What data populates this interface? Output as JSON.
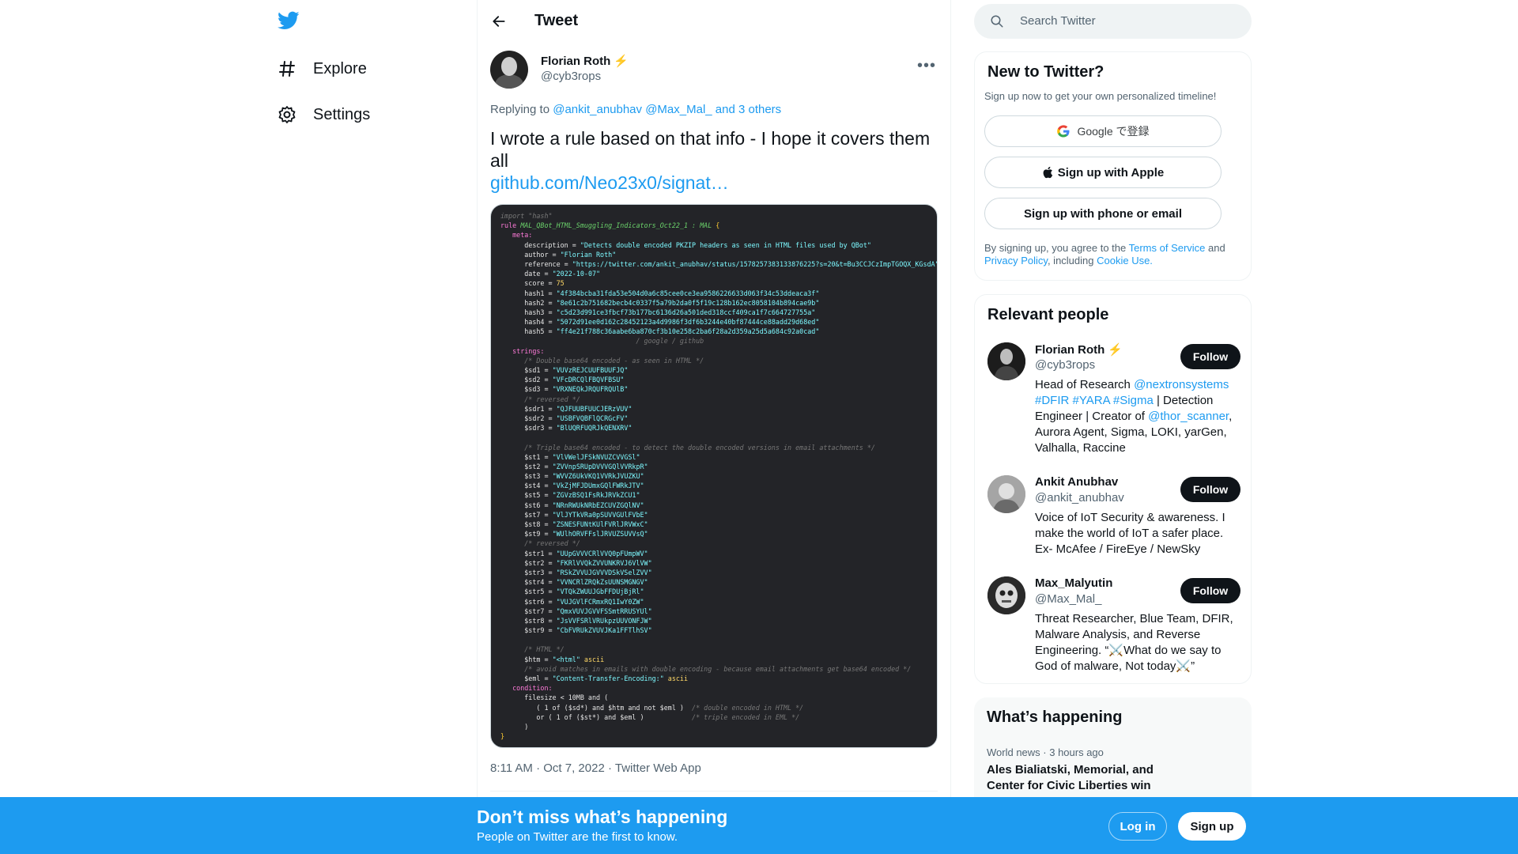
{
  "nav": {
    "logo_icon": "twitter-bird-icon",
    "explore_label": "Explore",
    "settings_label": "Settings"
  },
  "header": {
    "title": "Tweet"
  },
  "tweet": {
    "author_name": "Florian Roth",
    "author_badge": "⚡",
    "author_handle": "@cyb3rops",
    "replying_prefix": "Replying to",
    "replying_handles": "@ankit_anubhav @Max_Mal_ and 3 others",
    "text": "I wrote a rule based on that info - I hope it covers them all",
    "link": "github.com/Neo23x0/signat…",
    "meta": "8:11 AM · Oct 7, 2022 · Twitter Web App",
    "code_lines": [
      [
        "cmt",
        "import \"hash\""
      ],
      [
        "rule",
        "rule MAL_QBot_HTML_Smuggling_Indicators_Oct22_1 : MAL {"
      ],
      [
        "kw",
        "   meta:"
      ],
      [
        "kv",
        "      description = ",
        "\"Detects double encoded PKZIP headers as seen in HTML files used by QBot\""
      ],
      [
        "kv",
        "      author = ",
        "\"Florian Roth\""
      ],
      [
        "kv",
        "      reference = ",
        "\"https://twitter.com/ankit_anubhav/status/1578257383133876225?s=20&t=Bu3CCJCzImpTGOQX_KGsdA\""
      ],
      [
        "kv",
        "      date = ",
        "\"2022-10-07\""
      ],
      [
        "kn",
        "      score = ",
        "75"
      ],
      [
        "kv",
        "      hash1 = ",
        "\"4f384bcba31fda53e504d0a6c85cee0ce3ea9586226633d063f34c53ddeaca3f\""
      ],
      [
        "kv",
        "      hash2 = ",
        "\"8e61c2b751682becb4c0337f5a79b2da0f5f19c128b162ec8058104b894cae9b\""
      ],
      [
        "kv",
        "      hash3 = ",
        "\"c5d23d991ce3fbcf73b177bc6136d26a501ded318ccf409ca1f7c664727755a\""
      ],
      [
        "kv",
        "      hash4 = ",
        "\"5072d91ee0d162c28452123a4d9986f3df6b3244e40bf87444ce88add29d68ed\""
      ],
      [
        "kv",
        "      hash5 = ",
        "\"ff4e21f788c36aabe6ba870cf3b10e258c2ba6f28a2d359a25d5a684c92a0cad\""
      ],
      [
        "cmt",
        "                                  / google / github"
      ],
      [
        "kw",
        "   strings:"
      ],
      [
        "cmt",
        "      /* Double base64 encoded - as seen in HTML */"
      ],
      [
        "kv",
        "      $sd1 = ",
        "\"VUVzREJCUUFBUUFJQ\""
      ],
      [
        "kv",
        "      $sd2 = ",
        "\"VFcDRCQlFBQVFBSU\""
      ],
      [
        "kv",
        "      $sd3 = ",
        "\"VRXNEQkJRQUFRQUlB\""
      ],
      [
        "cmt",
        "      /* reversed */"
      ],
      [
        "kv",
        "      $sdr1 = ",
        "\"QJFUUBFUUCJERzVUV\""
      ],
      [
        "kv",
        "      $sdr2 = ",
        "\"USBFVQBFlQCRGcFV\""
      ],
      [
        "kv",
        "      $sdr3 = ",
        "\"BlUQRFUQRJkQENXRV\""
      ],
      [
        "blank",
        ""
      ],
      [
        "cmt",
        "      /* Triple base64 encoded - to detect the double encoded versions in email attachments */"
      ],
      [
        "kv",
        "      $st1 = ",
        "\"VlVWelJFSkNVUZCVVGSl\""
      ],
      [
        "kv",
        "      $st2 = ",
        "\"ZVVnpSRUpDVVVGQlVVRkpR\""
      ],
      [
        "kv",
        "      $st3 = ",
        "\"WVVZ6UkVKQ1VVRkJVUZKU\""
      ],
      [
        "kv",
        "      $st4 = ",
        "\"VkZjMFJDUmxGQlFWRkJTV\""
      ],
      [
        "kv",
        "      $st5 = ",
        "\"ZGVzBSQ1FsRkJRVkZCU1\""
      ],
      [
        "kv",
        "      $st6 = ",
        "\"NRnRWUkNRbEZCUVZGQlNV\""
      ],
      [
        "kv",
        "      $st7 = ",
        "\"VlJYTkVRa0pSUVVGUlFVbE\""
      ],
      [
        "kv",
        "      $st8 = ",
        "\"ZSNESFUNtKUlFVRlJRVWxC\""
      ],
      [
        "kv",
        "      $st9 = ",
        "\"WUlhORVFFslJRVUZSUVVsQ\""
      ],
      [
        "cmt",
        "      /* reversed */"
      ],
      [
        "kv",
        "      $str1 = ",
        "\"UUpGVVVCRlVVQ0pFUmpWV\""
      ],
      [
        "kv",
        "      $str2 = ",
        "\"FKRlVVQkZVVUNKRVJ6VlVW\""
      ],
      [
        "kv",
        "      $str3 = ",
        "\"RSkZVVUJGVVVDSkVSelZVV\""
      ],
      [
        "kv",
        "      $str4 = ",
        "\"VVNCRlZRQkZsUUNSMGNGV\""
      ],
      [
        "kv",
        "      $str5 = ",
        "\"VTQkZWUUJGbFFDUjBjRl\""
      ],
      [
        "kv",
        "      $str6 = ",
        "\"VUJGVlFCRmxRQ1IwY0ZW\""
      ],
      [
        "kv",
        "      $str7 = ",
        "\"QmxVUVJGVVFSSmtRRUSYUl\""
      ],
      [
        "kv",
        "      $str8 = ",
        "\"JsVVFSRlVRUkpzUUVONFJW\""
      ],
      [
        "kv",
        "      $str9 = ",
        "\"CbFVRUkZVUVJKa1FFTlhSV\""
      ],
      [
        "blank",
        ""
      ],
      [
        "cmt",
        "      /* HTML */"
      ],
      [
        "kva",
        "      $htm = ",
        "\"<html\"",
        "ascii"
      ],
      [
        "cmt",
        "      /* avoid matches in emails with double encoding - because email attachments get base64 encoded */"
      ],
      [
        "kva",
        "      $eml = ",
        "\"Content-Transfer-Encoding:\"",
        "ascii"
      ],
      [
        "kw",
        "   condition:"
      ],
      [
        "cond",
        "      filesize < 10MB and ("
      ],
      [
        "cond",
        "         ( 1 of ($sd*) and $htm and not $eml )  /* double encoded in HTML */"
      ],
      [
        "cond",
        "         or ( 1 of ($st*) and $eml )            /* triple encoded in EML */"
      ],
      [
        "cond",
        "      )"
      ],
      [
        "brace",
        "}"
      ]
    ]
  },
  "search": {
    "placeholder": "Search Twitter"
  },
  "new_to_twitter": {
    "title": "New to Twitter?",
    "subtitle": "Sign up now to get your own personalized timeline!",
    "google_label": "Google で登録",
    "apple_label": "Sign up with Apple",
    "phone_label": "Sign up with phone or email",
    "terms_prefix": "By signing up, you agree to the ",
    "terms_link": "Terms of Service",
    "terms_and": " and ",
    "privacy_link": "Privacy Policy",
    "terms_including": ", including ",
    "cookie_link": "Cookie Use."
  },
  "relevant_people": {
    "title": "Relevant people",
    "follow_label": "Follow",
    "people": [
      {
        "name": "Florian Roth",
        "badge": "⚡",
        "handle": "@cyb3rops",
        "bio_1": "Head of Research ",
        "bio_link1": "@nextronsystems",
        "bio_tags": "#DFIR #YARA #Sigma",
        "bio_2": " | Detection Engineer | Creator of ",
        "bio_link2": "@thor_scanner",
        "bio_3": ", Aurora Agent, Sigma, LOKI, yarGen, Valhalla, Raccine"
      },
      {
        "name": "Ankit Anubhav",
        "handle": "@ankit_anubhav",
        "bio": "Voice of IoT Security & awareness. I make the world of IoT a safer place. Ex- McAfee / FireEye / NewSky"
      },
      {
        "name": "Max_Malyutin",
        "handle": "@Max_Mal_",
        "bio": "Threat Researcher, Blue Team, DFIR, Malware Analysis, and Reverse Engineering. “⚔️What do we say to God of malware, Not today⚔️”"
      }
    ]
  },
  "happening": {
    "title": "What’s happening",
    "item_meta": "World news · 3 hours ago",
    "item_title": "Ales Bialiatski, Memorial, and Center for Civic Liberties win"
  },
  "banner": {
    "title": "Don’t miss what’s happening",
    "subtitle": "People on Twitter are the first to know.",
    "login_label": "Log in",
    "signup_label": "Sign up"
  },
  "colors": {
    "accent": "#1d9bf0",
    "text": "#0f1419",
    "muted": "#536471",
    "code_bg": "#232428"
  }
}
